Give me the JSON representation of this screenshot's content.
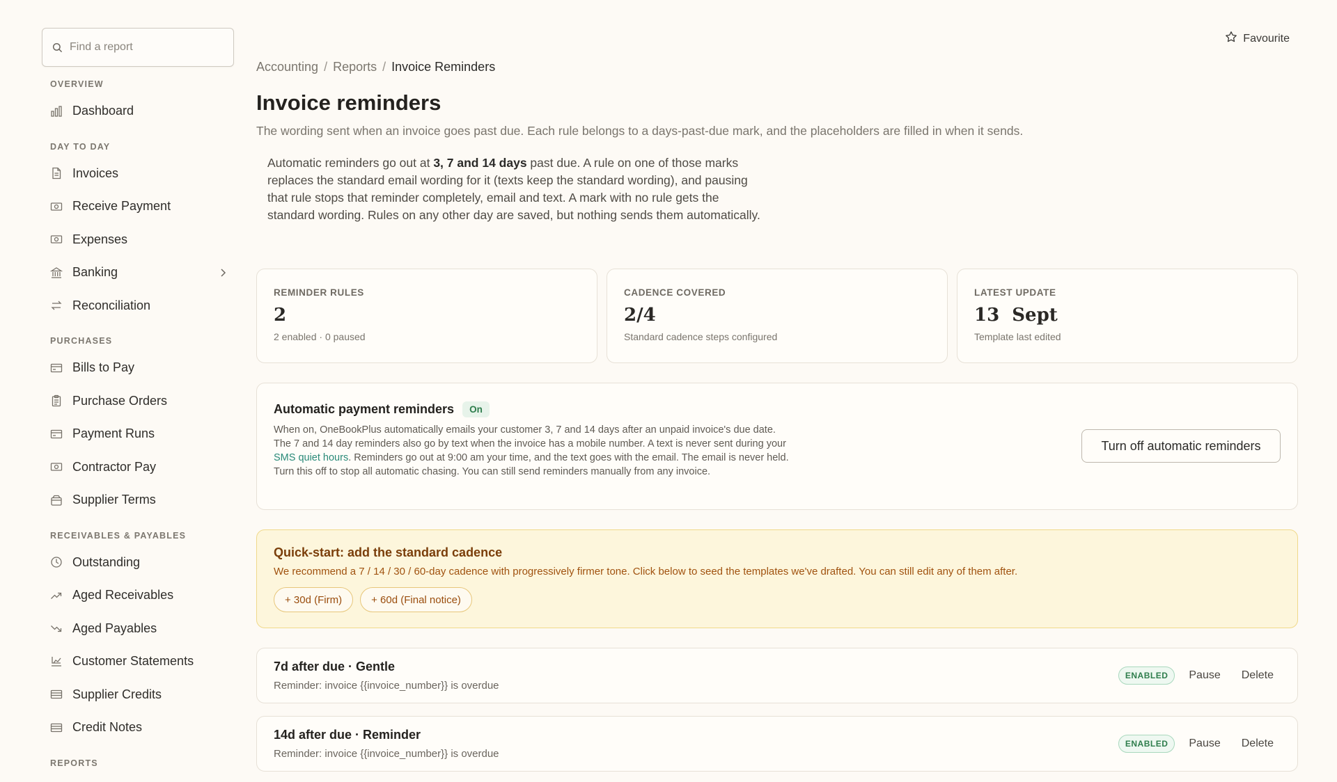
{
  "sidebar": {
    "search_placeholder": "Find a report",
    "sections": [
      {
        "title": "Overview",
        "items": [
          {
            "label": "Dashboard",
            "icon": "bar-chart-icon"
          }
        ]
      },
      {
        "title": "Day to day",
        "items": [
          {
            "label": "Invoices",
            "icon": "document-icon"
          },
          {
            "label": "Receive Payment",
            "icon": "banknote-icon"
          },
          {
            "label": "Expenses",
            "icon": "banknote-icon"
          },
          {
            "label": "Banking",
            "icon": "bank-icon",
            "has_chevron": true
          },
          {
            "label": "Reconciliation",
            "icon": "arrows-swap-icon"
          }
        ]
      },
      {
        "title": "Purchases",
        "items": [
          {
            "label": "Bills to Pay",
            "icon": "card-icon"
          },
          {
            "label": "Purchase Orders",
            "icon": "clipboard-icon"
          },
          {
            "label": "Payment Runs",
            "icon": "card-icon"
          },
          {
            "label": "Contractor Pay",
            "icon": "banknote-icon"
          },
          {
            "label": "Supplier Terms",
            "icon": "wallet-icon"
          }
        ]
      },
      {
        "title": "Receivables & Payables",
        "items": [
          {
            "label": "Outstanding",
            "icon": "clock-icon"
          },
          {
            "label": "Aged Receivables",
            "icon": "trend-up-icon"
          },
          {
            "label": "Aged Payables",
            "icon": "trend-down-icon"
          },
          {
            "label": "Customer Statements",
            "icon": "statement-icon"
          },
          {
            "label": "Supplier Credits",
            "icon": "ledger-icon"
          },
          {
            "label": "Credit Notes",
            "icon": "ledger-icon"
          }
        ]
      },
      {
        "title": "Reports",
        "items": []
      }
    ]
  },
  "header": {
    "favourite_label": "Favourite",
    "breadcrumb": [
      "Accounting",
      "Reports",
      "Invoice Reminders"
    ],
    "title": "Invoice reminders",
    "subtitle": "The wording sent when an invoice goes past due. Each rule belongs to a days-past-due mark, and the placeholders are filled in when it sends.",
    "intro_before": "Automatic reminders go out at ",
    "intro_bold": "3, 7 and 14 days",
    "intro_after": " past due. A rule on one of those marks replaces the standard email wording for it (texts keep the standard wording), and pausing that rule stops that reminder completely, email and text. A mark with no rule gets the standard wording. Rules on any other day are saved, but nothing sends them automatically."
  },
  "stats": [
    {
      "label": "Reminder rules",
      "value": "2",
      "sub": "2 enabled · 0 paused"
    },
    {
      "label": "Cadence covered",
      "value": "2/4",
      "sub": "Standard cadence steps configured"
    },
    {
      "label": "Latest update",
      "value": "13  Sept",
      "sub": "Template last edited"
    }
  ],
  "auto_panel": {
    "title": "Automatic payment reminders",
    "status": "On",
    "desc_before": "When on, OneBookPlus automatically emails your customer 3, 7 and 14 days after an unpaid invoice's due date. The 7 and 14 day reminders also go by text when the invoice has a mobile number. A text is never sent during your ",
    "desc_link": "SMS quiet hours",
    "desc_after": ". Reminders go out at 9:00 am your time, and the text goes with the email. The email is never held. Turn this off to stop all automatic chasing. You can still send reminders manually from any invoice.",
    "button_label": "Turn off automatic reminders"
  },
  "quick_start": {
    "title": "Quick-start: add the standard cadence",
    "desc": "We recommend a 7 / 14 / 30 / 60-day cadence with progressively firmer tone. Click below to seed the templates we've drafted. You can still edit any of them after.",
    "chips": [
      "+ 30d (Firm)",
      "+ 60d (Final notice)"
    ]
  },
  "rules": [
    {
      "title": "7d after due · Gentle",
      "subject": "Reminder: invoice {{invoice_number}} is overdue",
      "status": "ENABLED",
      "pause_label": "Pause",
      "delete_label": "Delete"
    },
    {
      "title": "14d after due · Reminder",
      "subject": "Reminder: invoice {{invoice_number}} is overdue",
      "status": "ENABLED",
      "pause_label": "Pause",
      "delete_label": "Delete"
    }
  ],
  "colors": {
    "background": "#fdfaf5",
    "accent_link": "#2a8a78",
    "enabled_green": "#2e7d4c",
    "quickstart_bg": "#fdf6dc",
    "quickstart_text": "#a0520f"
  }
}
